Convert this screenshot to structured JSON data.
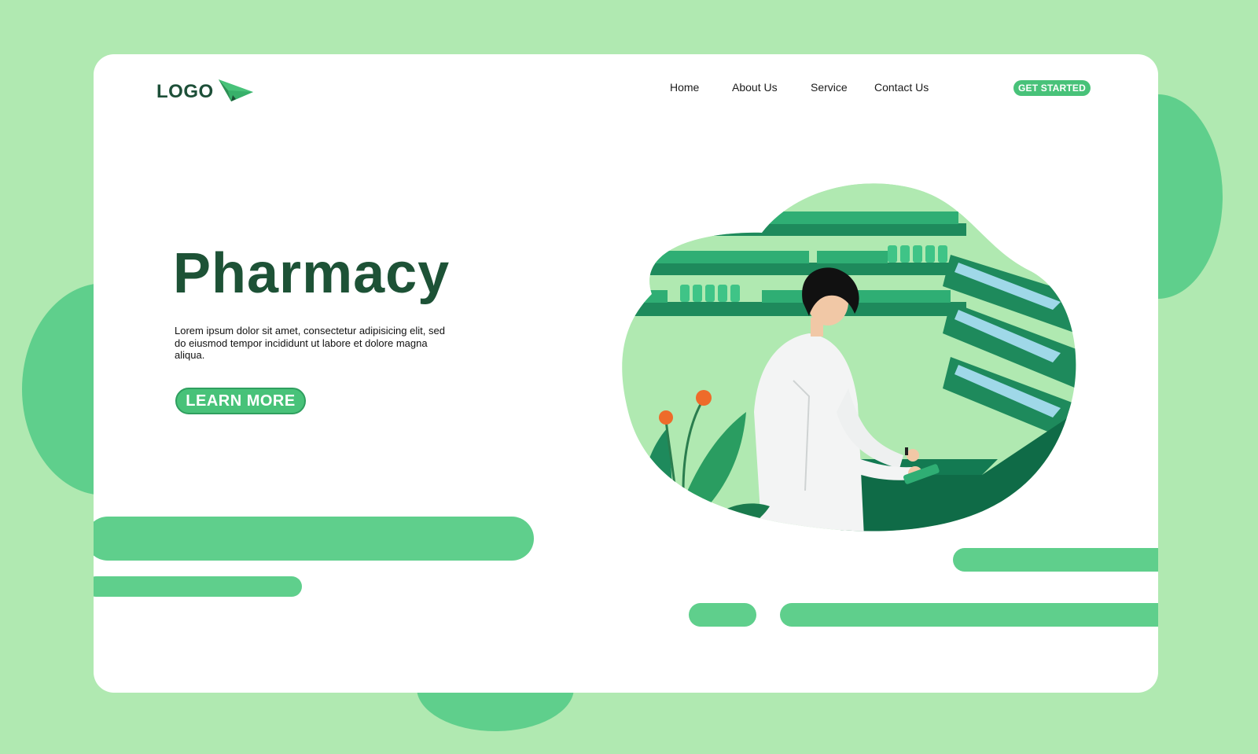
{
  "colors": {
    "page_background": "#b0e9b1",
    "accent": "#48c279",
    "dark_green": "#1d5236",
    "card": "#ffffff"
  },
  "header": {
    "logo_text": "LOGO",
    "logo_icon": "paper-plane-icon",
    "nav": [
      "Home",
      "About Us",
      "Service",
      "Contact Us"
    ],
    "cta_label": "GET STARTED"
  },
  "hero": {
    "title": "Pharmacy",
    "description": "Lorem ipsum dolor sit amet, consectetur adipisicing elit, sed do eiusmod tempor incididunt ut labore et dolore magna aliqua.",
    "button_label": "LEARN MORE"
  },
  "illustration": {
    "subject": "pharmacist-illustration"
  }
}
